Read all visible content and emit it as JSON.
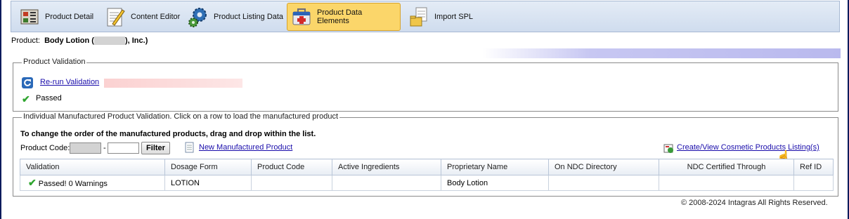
{
  "toolbar": {
    "items": [
      {
        "label": "Product Detail"
      },
      {
        "label": "Content Editor"
      },
      {
        "label": "Product Listing Data"
      },
      {
        "label": "Product Data Elements"
      },
      {
        "label": "Import SPL"
      }
    ]
  },
  "product": {
    "label": "Product:",
    "name_start": "Body Lotion (",
    "name_end": "), Inc.)"
  },
  "validation": {
    "legend": "Product Validation",
    "rerun_label": "Re-run Validation",
    "status": "Passed"
  },
  "manufactured": {
    "legend": "Individual Manufactured Product Validation. Click on a row to load the manufactured product",
    "instruction": "To change the order of the manufactured products, drag and drop within the list.",
    "product_code_label": "Product Code:",
    "separator": "-",
    "filter_label": "Filter",
    "new_link": "New Manufactured Product",
    "cosmetic_link": "Create/View Cosmetic Products Listing(s)",
    "columns": [
      "Validation",
      "Dosage Form",
      "Product Code",
      "Active Ingredients",
      "Proprietary Name",
      "On NDC Directory",
      "NDC Certified Through",
      "Ref ID"
    ],
    "rows": [
      {
        "validation": "Passed! 0 Warnings",
        "dosage_form": "LOTION",
        "product_code": "",
        "active_ingredients": "",
        "proprietary_name": "Body Lotion",
        "on_ndc": "",
        "ndc_certified": "",
        "ref_id": ""
      }
    ]
  },
  "footer": "© 2008-2024 Intagras All Rights Reserved.",
  "colors": {
    "active_tab": "#fbd66a",
    "link": "#1a0dab",
    "check": "#2fa52f"
  }
}
